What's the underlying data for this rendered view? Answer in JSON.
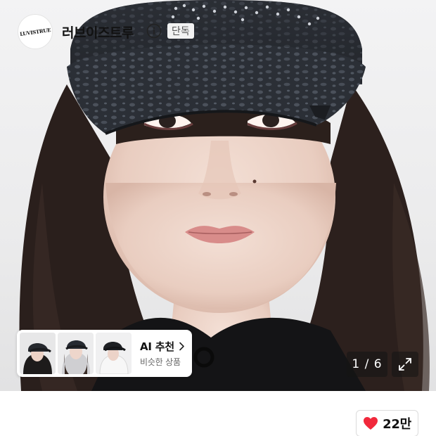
{
  "hero": {
    "image_alt": "Model wearing black leopard-print rhinestone cap",
    "counter": "1 / 6"
  },
  "ai_recommend": {
    "title": "AI 추천",
    "subtitle": "비슷한 상품",
    "thumbnails": [
      "thumb-1",
      "thumb-2",
      "thumb-3"
    ]
  },
  "icons": {
    "expand": "expand-icon",
    "chevron": "chevron-right-icon",
    "info": "info-icon",
    "heart": "heart-icon"
  },
  "brand": {
    "logo_text": "LUVISTRUE",
    "name": "러브이즈트루",
    "badge": "단독"
  },
  "like": {
    "count": "22만"
  },
  "colors": {
    "heart": "#f1283b",
    "overlay": "#141414"
  }
}
